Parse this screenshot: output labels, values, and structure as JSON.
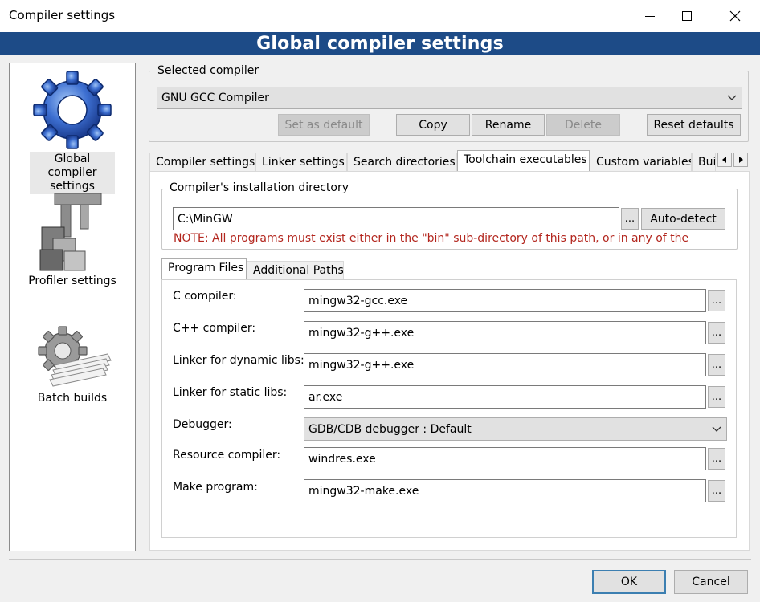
{
  "window": {
    "title": "Compiler settings",
    "controls": {
      "minimize": "minimize-icon",
      "maximize": "maximize-icon",
      "close": "close-icon"
    }
  },
  "banner": {
    "title": "Global compiler settings"
  },
  "sidebar": {
    "items": [
      {
        "label": "Global compiler settings",
        "icon": "gear-icon",
        "selected": true
      },
      {
        "label": "Profiler settings",
        "icon": "profiler-icon",
        "selected": false
      },
      {
        "label": "Batch builds",
        "icon": "batch-builds-icon",
        "selected": false
      }
    ]
  },
  "selected_compiler": {
    "legend": "Selected compiler",
    "value": "GNU GCC Compiler",
    "buttons": {
      "set_default": "Set as default",
      "copy": "Copy",
      "rename": "Rename",
      "delete": "Delete",
      "reset_defaults": "Reset defaults"
    }
  },
  "tabs": [
    "Compiler settings",
    "Linker settings",
    "Search directories",
    "Toolchain executables",
    "Custom variables",
    "Bui"
  ],
  "active_tab": "Toolchain executables",
  "installation": {
    "legend": "Compiler's installation directory",
    "path": "C:\\MinGW",
    "browse": "...",
    "auto_detect": "Auto-detect",
    "note": "NOTE: All programs must exist either in the \"bin\" sub-directory of this path, or in any of the"
  },
  "subtabs": [
    "Program Files",
    "Additional Paths"
  ],
  "programs": {
    "c_compiler": {
      "label": "C compiler:",
      "value": "mingw32-gcc.exe"
    },
    "cpp_compiler": {
      "label": "C++ compiler:",
      "value": "mingw32-g++.exe"
    },
    "linker_dynamic": {
      "label": "Linker for dynamic libs:",
      "value": "mingw32-g++.exe"
    },
    "linker_static": {
      "label": "Linker for static libs:",
      "value": "ar.exe"
    },
    "debugger": {
      "label": "Debugger:",
      "value": "GDB/CDB debugger : Default"
    },
    "resource_compiler": {
      "label": "Resource compiler:",
      "value": "windres.exe"
    },
    "make_program": {
      "label": "Make program:",
      "value": "mingw32-make.exe"
    },
    "browse": "..."
  },
  "footer": {
    "ok": "OK",
    "cancel": "Cancel"
  },
  "colors": {
    "banner": "#1d4b87",
    "note": "#b3261e",
    "default_button_border": "#3c7fb1"
  }
}
